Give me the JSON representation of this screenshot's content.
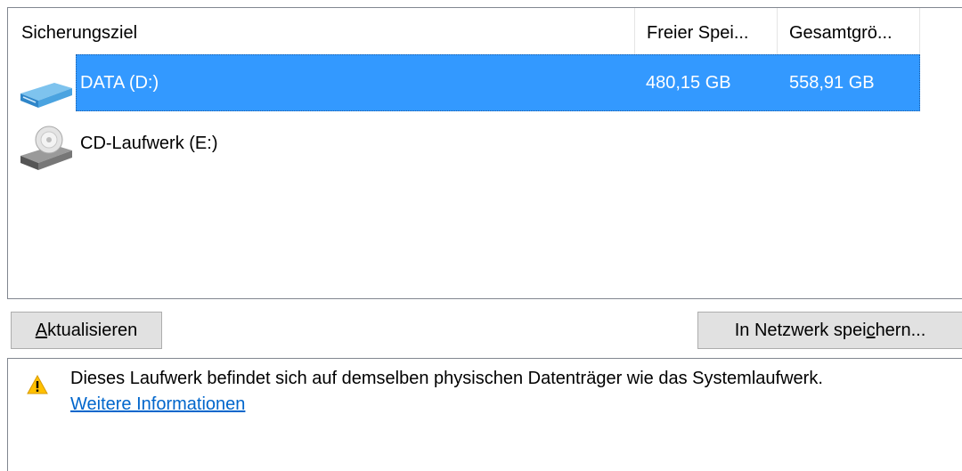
{
  "listview": {
    "columns": [
      "Sicherungsziel",
      "Freier Spei...",
      "Gesamtgrö..."
    ],
    "rows": [
      {
        "name": "DATA (D:)",
        "free": "480,15 GB",
        "total": "558,91 GB",
        "icon": "hard-drive-icon",
        "selected": true
      },
      {
        "name": "CD-Laufwerk (E:)",
        "free": "",
        "total": "",
        "icon": "cd-drive-icon",
        "selected": false
      }
    ]
  },
  "buttons": {
    "refresh_mnemonic": "A",
    "refresh_rest": "ktualisieren",
    "network_pre": "In Netzwerk spei",
    "network_mnemonic": "c",
    "network_post": "hern..."
  },
  "info": {
    "warning_icon": "warning-icon",
    "message": "Dieses Laufwerk befindet sich auf demselben physischen Datenträger wie das Systemlaufwerk.",
    "link": "Weitere Informationen"
  },
  "colors": {
    "selection": "#3399ff",
    "link": "#0066cc",
    "button_face": "#e1e1e1",
    "warning": "#ffc000"
  }
}
